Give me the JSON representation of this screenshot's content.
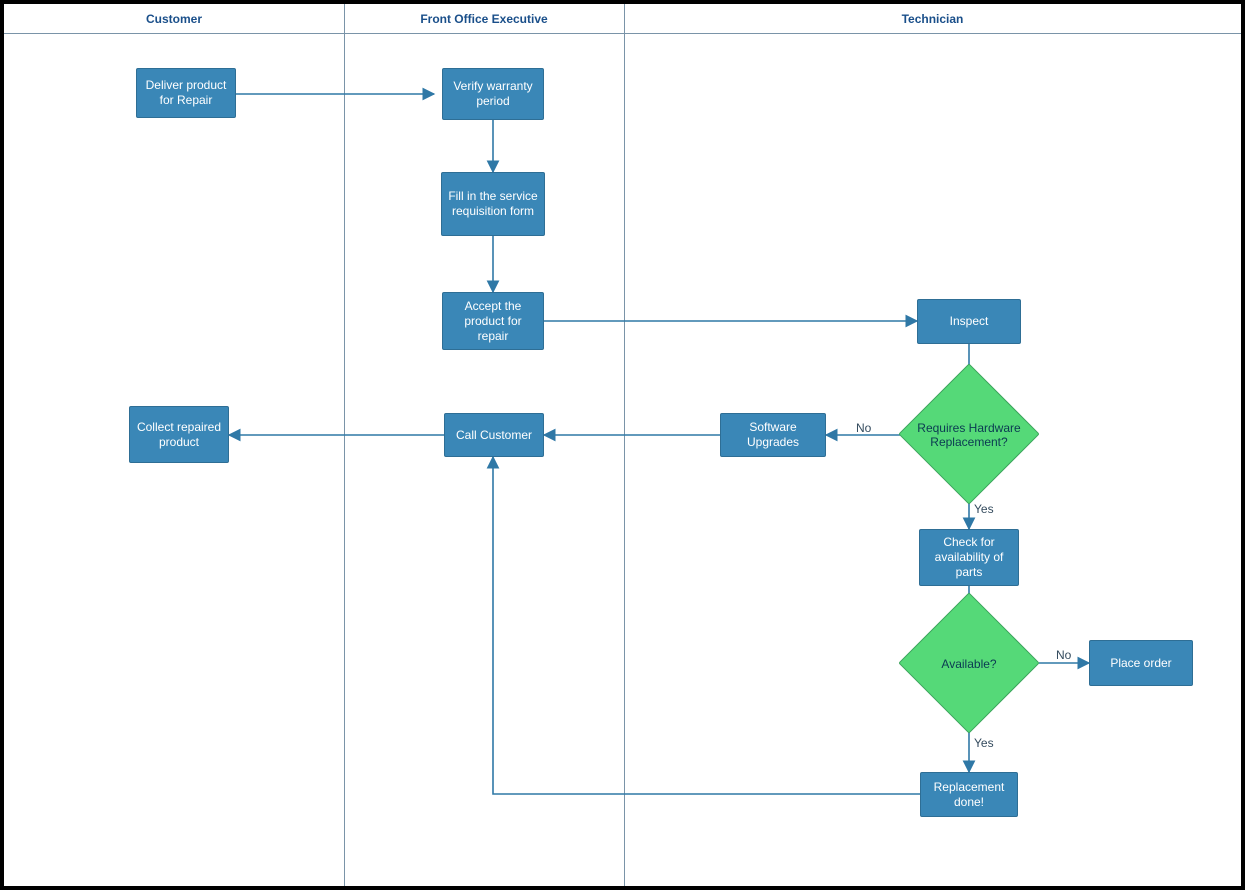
{
  "lanes": [
    {
      "name": "Customer"
    },
    {
      "name": "Front Office Executive"
    },
    {
      "name": "Technician"
    }
  ],
  "nodes": {
    "deliver": {
      "label": "Deliver product for Repair"
    },
    "verify": {
      "label": "Verify warranty period"
    },
    "fillForm": {
      "label": "Fill in the service requisition form"
    },
    "accept": {
      "label": "Accept the product for repair"
    },
    "callCustomer": {
      "label": "Call Customer"
    },
    "collect": {
      "label": "Collect repaired product"
    },
    "inspect": {
      "label": "Inspect"
    },
    "reqHw": {
      "label": "Requires Hardware Replacement?"
    },
    "swUpgrades": {
      "label": "Software Upgrades"
    },
    "checkParts": {
      "label": "Check for availability of parts"
    },
    "available": {
      "label": "Available?"
    },
    "placeOrder": {
      "label": "Place order"
    },
    "replaceDone": {
      "label": "Replacement done!"
    }
  },
  "edgeLabels": {
    "reqHwNo": "No",
    "reqHwYes": "Yes",
    "availNo": "No",
    "availYes": "Yes"
  },
  "colors": {
    "task": "#3a87b7",
    "decision": "#55d978",
    "laneHeaderText": "#1a4f8a",
    "border": "#7a94a8"
  }
}
